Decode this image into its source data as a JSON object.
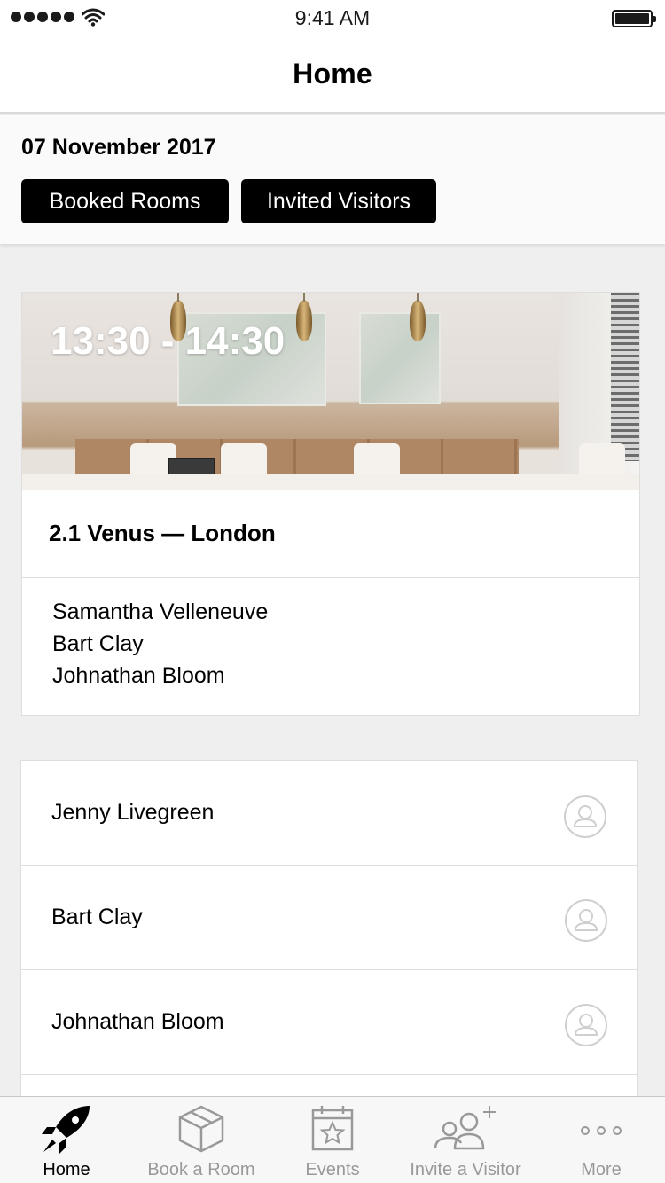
{
  "status_bar": {
    "time": "9:41 AM",
    "signal_icon": "signal-dots-icon",
    "wifi_icon": "wifi-icon",
    "battery_icon": "battery-icon",
    "battery_level": 1.0
  },
  "nav": {
    "title": "Home"
  },
  "filter": {
    "date": "07 November 2017",
    "buttons": [
      {
        "label": "Booked Rooms"
      },
      {
        "label": "Invited Visitors"
      }
    ]
  },
  "booking": {
    "time_range": "13:30 - 14:30",
    "room": "2.1 Venus — London",
    "attendees": [
      "Samantha Velleneuve",
      "Bart Clay",
      "Johnathan Bloom"
    ]
  },
  "visitors": [
    {
      "name": "Jenny Livegreen",
      "icon": "user-circle-icon"
    },
    {
      "name": "Bart Clay",
      "icon": "user-circle-icon"
    },
    {
      "name": "Johnathan Bloom",
      "icon": "user-circle-icon"
    }
  ],
  "tabs": [
    {
      "label": "Home",
      "icon": "rocket-icon",
      "active": true
    },
    {
      "label": "Book a Room",
      "icon": "cube-icon",
      "active": false
    },
    {
      "label": "Events",
      "icon": "calendar-star-icon",
      "active": false
    },
    {
      "label": "Invite a Visitor",
      "icon": "add-people-icon",
      "active": false
    },
    {
      "label": "More",
      "icon": "more-dots-icon",
      "active": false
    }
  ],
  "colors": {
    "accent": "#000000",
    "background": "#efefef",
    "tab_inactive": "#999999"
  }
}
